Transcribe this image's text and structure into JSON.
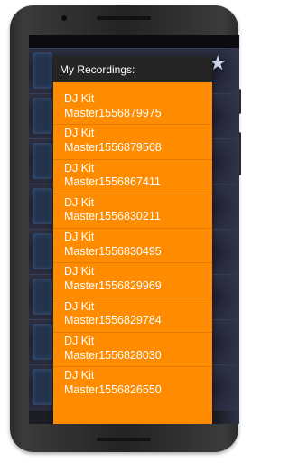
{
  "dialog": {
    "title": "My Recordings:"
  },
  "recordings": [
    {
      "label": "DJ Kit\nMaster1556879975"
    },
    {
      "label": "DJ Kit\nMaster1556879568"
    },
    {
      "label": "DJ Kit\nMaster1556867411"
    },
    {
      "label": "DJ Kit\nMaster1556830211"
    },
    {
      "label": "DJ Kit\nMaster1556830495"
    },
    {
      "label": "DJ Kit\nMaster1556829969"
    },
    {
      "label": "DJ Kit\nMaster1556829784"
    },
    {
      "label": "DJ Kit\nMaster1556828030"
    },
    {
      "label": "DJ Kit\nMaster1556826550"
    }
  ],
  "colors": {
    "dialog_background": "#ff8c00",
    "dialog_header": "#252525",
    "item_text": "#ffffff",
    "device_body": "#2a2a2a"
  },
  "icons": {
    "background_star": "star-icon"
  }
}
